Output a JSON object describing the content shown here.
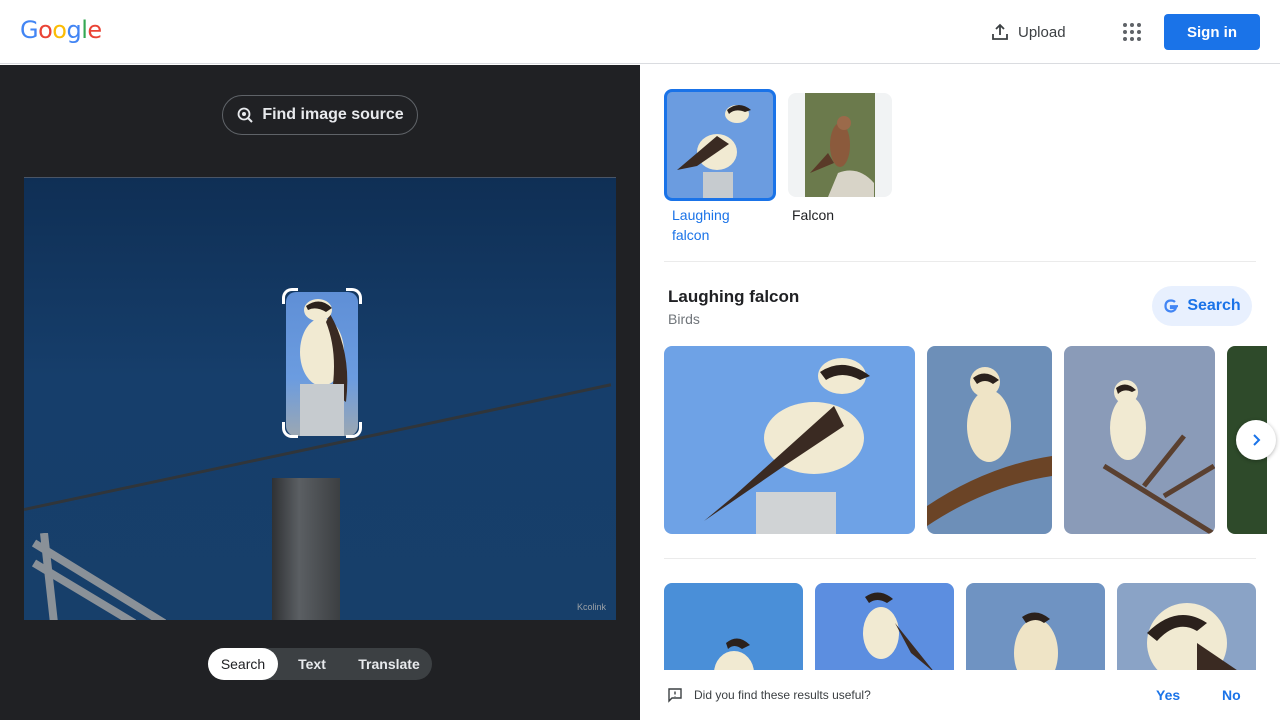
{
  "header": {
    "logo_letters": [
      {
        "ch": "G",
        "color": "#4285F4"
      },
      {
        "ch": "o",
        "color": "#EA4335"
      },
      {
        "ch": "o",
        "color": "#FBBC05"
      },
      {
        "ch": "g",
        "color": "#4285F4"
      },
      {
        "ch": "l",
        "color": "#34A853"
      },
      {
        "ch": "e",
        "color": "#EA4335"
      }
    ],
    "upload_label": "Upload",
    "apps_icon": "apps-grid-icon",
    "signin_label": "Sign in"
  },
  "left": {
    "find_source_label": "Find image source",
    "watermark": "Kcolink",
    "tabs": [
      {
        "label": "Search",
        "active": true
      },
      {
        "label": "Text",
        "active": false
      },
      {
        "label": "Translate",
        "active": false
      }
    ]
  },
  "right": {
    "chips": [
      {
        "label": "Laughing falcon",
        "selected": true
      },
      {
        "label": "Falcon",
        "selected": false
      }
    ],
    "kg_title": "Laughing falcon",
    "kg_subtitle": "Birds",
    "search_button_label": "Search",
    "feedback_question": "Did you find these results useful?",
    "feedback_yes": "Yes",
    "feedback_no": "No"
  },
  "colors": {
    "accent": "#1a73e8",
    "dark_panel": "#202124"
  }
}
